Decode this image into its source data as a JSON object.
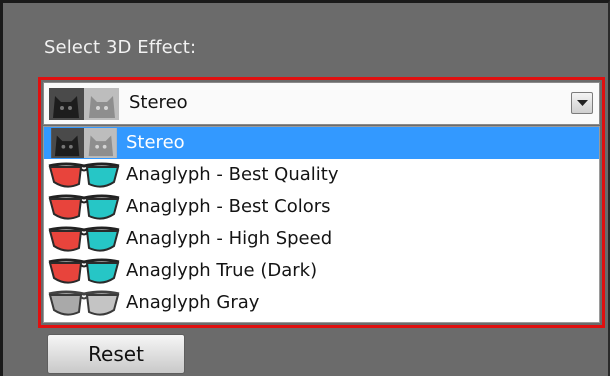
{
  "panel": {
    "heading": "Select 3D Effect:"
  },
  "combo": {
    "selected_label": "Stereo",
    "icon": "cat-stereo-thumbnail"
  },
  "list": {
    "items": [
      {
        "label": "Stereo",
        "icon": "cat-stereo-thumbnail",
        "selected": true
      },
      {
        "label": "Anaglyph - Best Quality",
        "icon": "red-cyan-glasses-icon",
        "selected": false
      },
      {
        "label": "Anaglyph - Best Colors",
        "icon": "red-cyan-glasses-icon",
        "selected": false
      },
      {
        "label": "Anaglyph - High Speed",
        "icon": "red-cyan-glasses-icon",
        "selected": false
      },
      {
        "label": "Anaglyph True (Dark)",
        "icon": "red-cyan-glasses-icon",
        "selected": false
      },
      {
        "label": "Anaglyph Gray",
        "icon": "gray-glasses-icon",
        "selected": false
      }
    ]
  },
  "reset_button": {
    "label": "Reset"
  },
  "colors": {
    "panel_bg": "#6b6b6b",
    "highlight_border": "#e01010",
    "selection": "#3399ff"
  }
}
